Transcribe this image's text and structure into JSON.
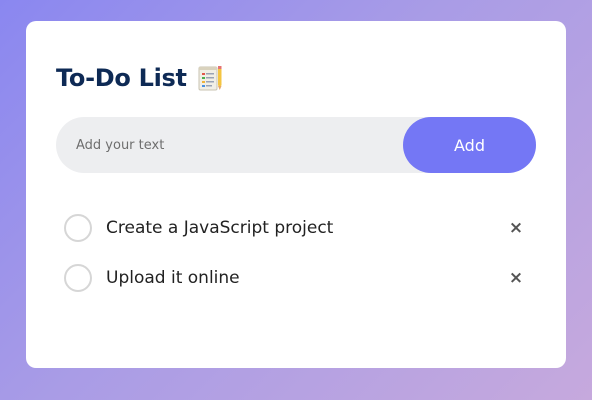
{
  "header": {
    "title": "To-Do List",
    "icon": "notepad-icon"
  },
  "input": {
    "placeholder": "Add your text",
    "value": ""
  },
  "add_button": {
    "label": "Add"
  },
  "tasks": [
    {
      "text": "Create a JavaScript project",
      "checked": false,
      "delete_label": "×"
    },
    {
      "text": "Upload it online",
      "checked": false,
      "delete_label": "×"
    }
  ],
  "colors": {
    "accent": "#7477f5",
    "title": "#0e2a55",
    "input_bg": "#edeef0"
  }
}
